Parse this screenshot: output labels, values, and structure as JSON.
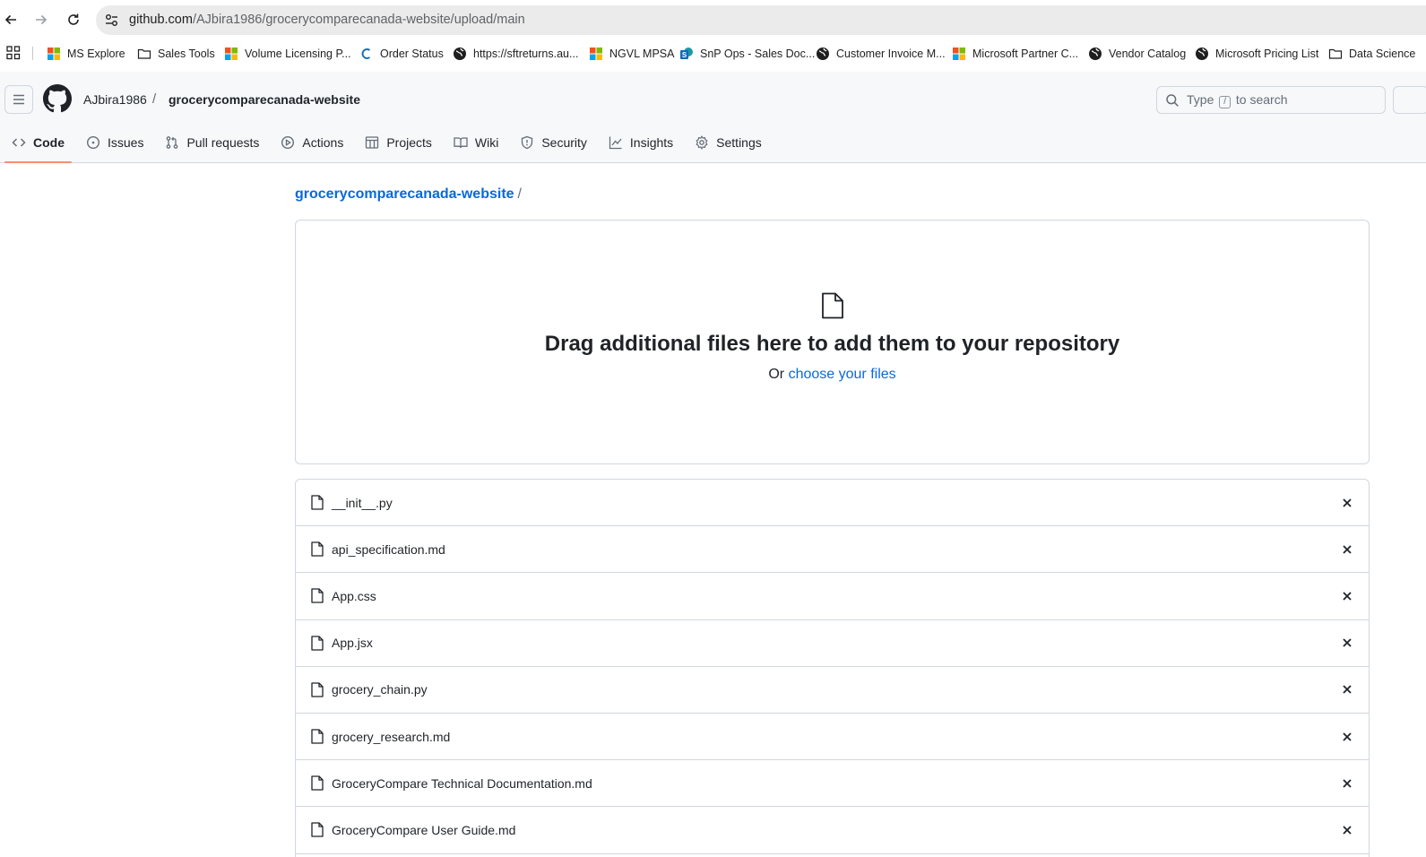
{
  "browser": {
    "url_host": "github.com",
    "url_path": "/AJbira1986/grocerycomparecanada-website/upload/main"
  },
  "bookmarks": [
    {
      "label": "MS Explore",
      "icon": "microsoft-logo-icon"
    },
    {
      "label": "Sales Tools",
      "icon": "folder-icon"
    },
    {
      "label": "Volume Licensing P...",
      "icon": "microsoft-logo-icon"
    },
    {
      "label": "Order Status",
      "icon": "c-logo-icon"
    },
    {
      "label": "https://sftreturns.au...",
      "icon": "globe-icon"
    },
    {
      "label": "NGVL MPSA",
      "icon": "microsoft-logo-icon"
    },
    {
      "label": "SnP Ops - Sales Doc...",
      "icon": "sharepoint-icon"
    },
    {
      "label": "Customer Invoice M...",
      "icon": "globe-icon"
    },
    {
      "label": "Microsoft Partner C...",
      "icon": "microsoft-logo-icon"
    },
    {
      "label": "Vendor Catalog",
      "icon": "globe-icon"
    },
    {
      "label": "Microsoft Pricing List",
      "icon": "globe-icon"
    },
    {
      "label": "Data Science",
      "icon": "folder-icon"
    }
  ],
  "header": {
    "owner": "AJbira1986",
    "separator": "/",
    "repo": "grocerycomparecanada-website",
    "search_prefix": "Type",
    "search_key": "/",
    "search_suffix": "to search"
  },
  "tabs": [
    {
      "label": "Code",
      "icon": "code-icon",
      "active": true
    },
    {
      "label": "Issues",
      "icon": "issue-icon"
    },
    {
      "label": "Pull requests",
      "icon": "pull-request-icon"
    },
    {
      "label": "Actions",
      "icon": "play-icon"
    },
    {
      "label": "Projects",
      "icon": "table-icon"
    },
    {
      "label": "Wiki",
      "icon": "book-icon"
    },
    {
      "label": "Security",
      "icon": "shield-icon"
    },
    {
      "label": "Insights",
      "icon": "graph-icon"
    },
    {
      "label": "Settings",
      "icon": "gear-icon"
    }
  ],
  "main": {
    "breadcrumb_repo": "grocerycomparecanada-website",
    "breadcrumb_sep": "/",
    "dropzone_title": "Drag additional files here to add them to your repository",
    "dropzone_or": "Or",
    "dropzone_link": "choose your files"
  },
  "files": [
    "__init__.py",
    "api_specification.md",
    "App.css",
    "App.jsx",
    "grocery_chain.py",
    "grocery_research.md",
    "GroceryCompare Technical Documentation.md",
    "GroceryCompare User Guide.md"
  ],
  "colors": {
    "link": "#0969da",
    "active_tab_underline": "#fd8c73",
    "border": "#d0d7de"
  }
}
